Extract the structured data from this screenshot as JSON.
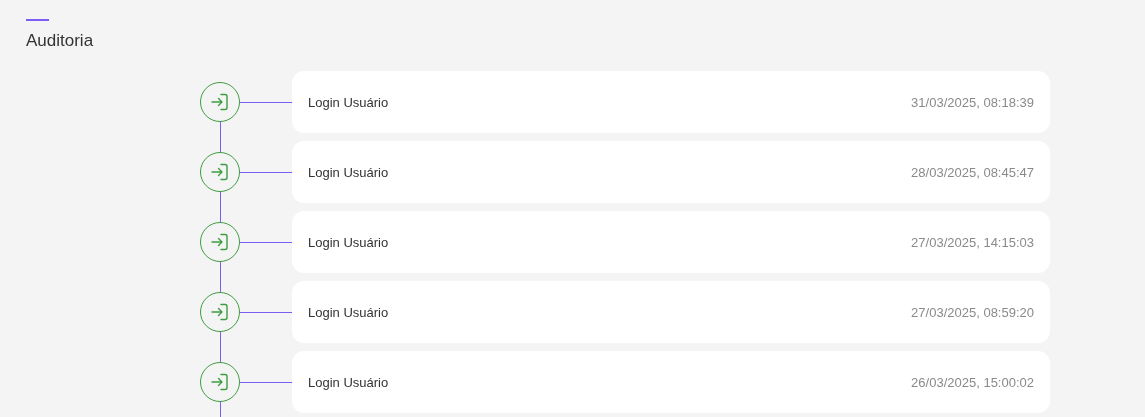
{
  "page": {
    "title": "Auditoria"
  },
  "events": [
    {
      "label": "Login Usuário",
      "timestamp": "31/03/2025, 08:18:39"
    },
    {
      "label": "Login Usuário",
      "timestamp": "28/03/2025, 08:45:47"
    },
    {
      "label": "Login Usuário",
      "timestamp": "27/03/2025, 14:15:03"
    },
    {
      "label": "Login Usuário",
      "timestamp": "27/03/2025, 08:59:20"
    },
    {
      "label": "Login Usuário",
      "timestamp": "26/03/2025, 15:00:02"
    }
  ]
}
